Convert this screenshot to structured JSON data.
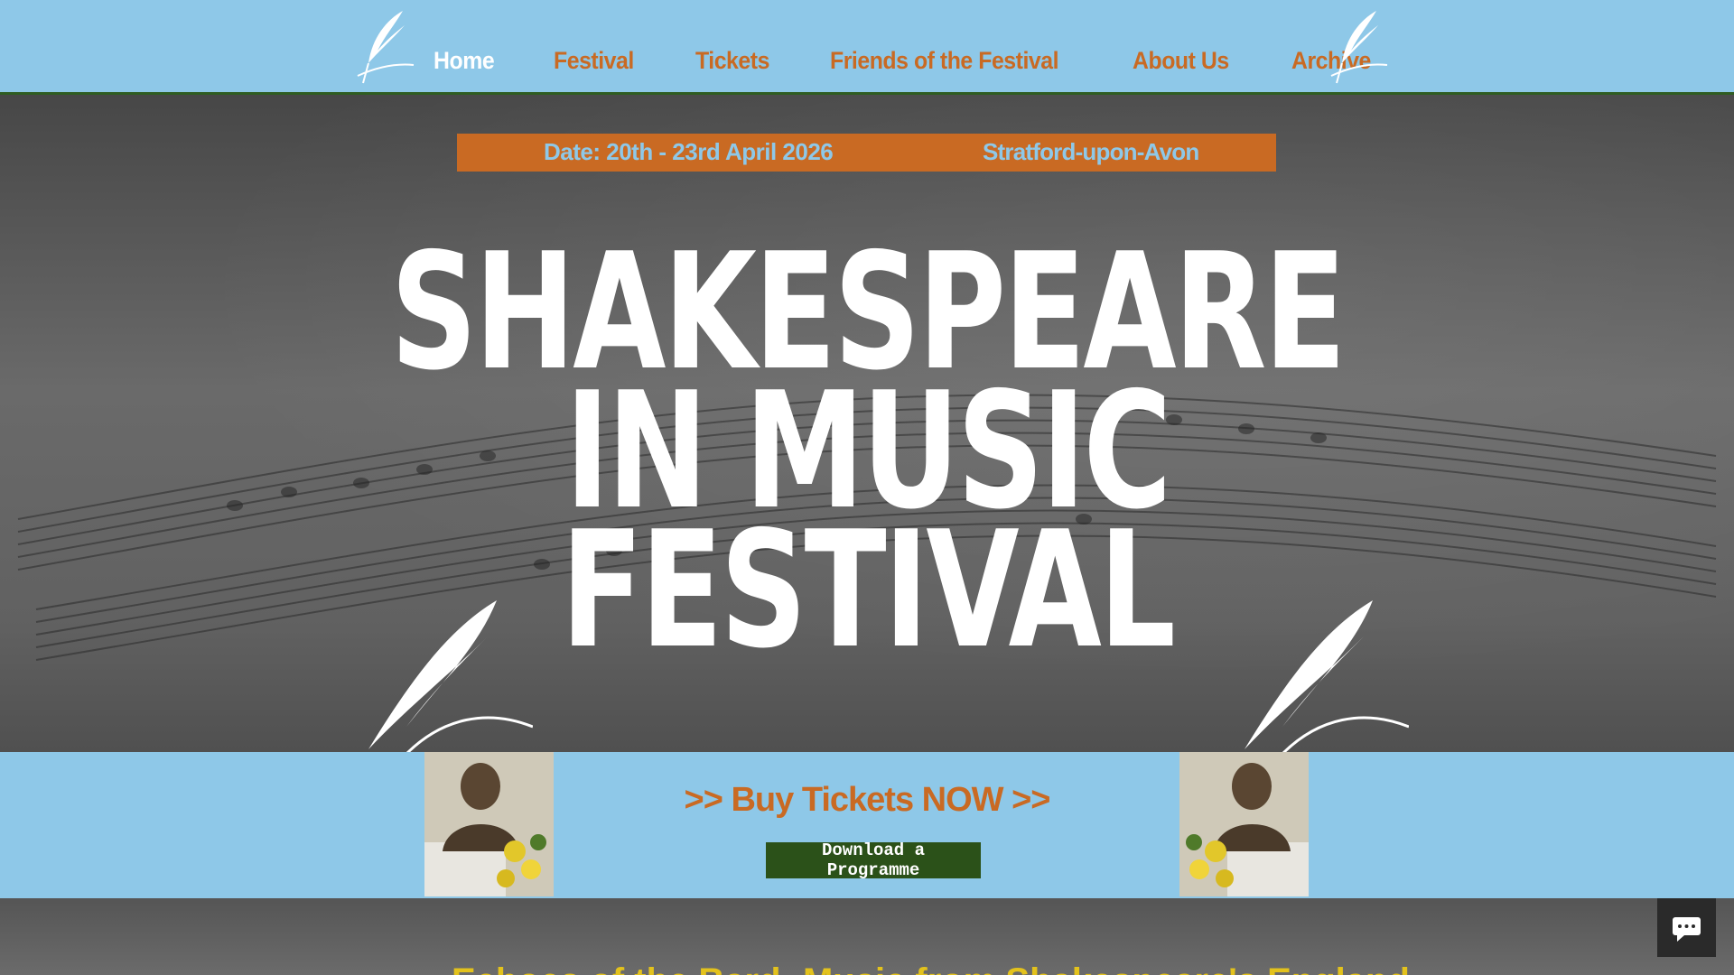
{
  "nav": {
    "items": [
      {
        "label": "Home",
        "active": true
      },
      {
        "label": "Festival",
        "active": false
      },
      {
        "label": "Tickets",
        "active": false
      },
      {
        "label": "Friends of the Festival",
        "active": false
      },
      {
        "label": "About Us",
        "active": false
      },
      {
        "label": "Archive",
        "active": false
      }
    ]
  },
  "info_bar": {
    "date": "Date: 20th - 23rd April 2026",
    "location": "Stratford-upon-Avon"
  },
  "hero": {
    "title_line1": "SHAKESPEARE",
    "title_line2": "IN MUSIC",
    "title_line3": "FESTIVAL",
    "background_icon": "sheet-music"
  },
  "tickets": {
    "buy_label": ">> Buy Tickets NOW >>",
    "download_label": "Download a Programme"
  },
  "lower": {
    "heading_partial": "Echoes of the Bard: Music from Shakespeare's England"
  },
  "icons": {
    "header_quill": "quill-icon",
    "hero_quill": "quill-icon",
    "bust": "shakespeare-bust-photo",
    "chat": "chat-icon"
  },
  "colors": {
    "header_bg": "#8ec8e8",
    "accent_orange": "#c96a23",
    "dark_green": "#2b5119",
    "title_white": "#ffffff",
    "lower_heading": "#e3c21c"
  }
}
